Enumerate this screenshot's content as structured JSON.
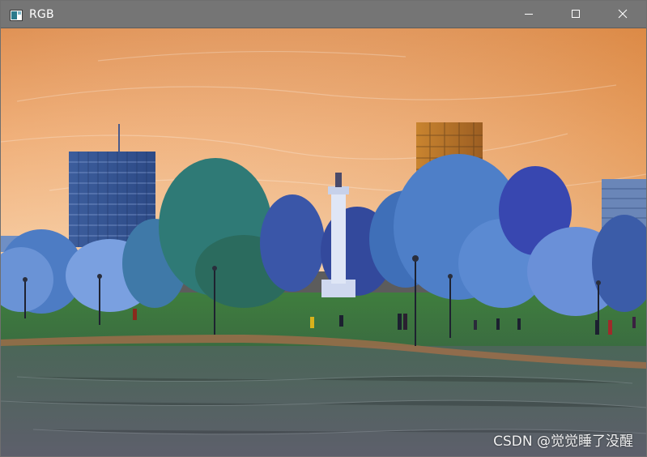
{
  "window": {
    "title": "RGB",
    "controls": {
      "minimize_icon": "minimize-icon",
      "maximize_icon": "maximize-icon",
      "close_icon": "close-icon"
    }
  },
  "image": {
    "watermark": "CSDN @觉觉睡了没醒"
  },
  "colors": {
    "titlebar": "#757575",
    "sky_top": "#e3955a",
    "sky_bottom": "#f3c08e",
    "trees_blue": "#3f6fb0",
    "trees_teal": "#2f6f73",
    "grass": "#3d7a3c",
    "path": "#a0704b"
  }
}
